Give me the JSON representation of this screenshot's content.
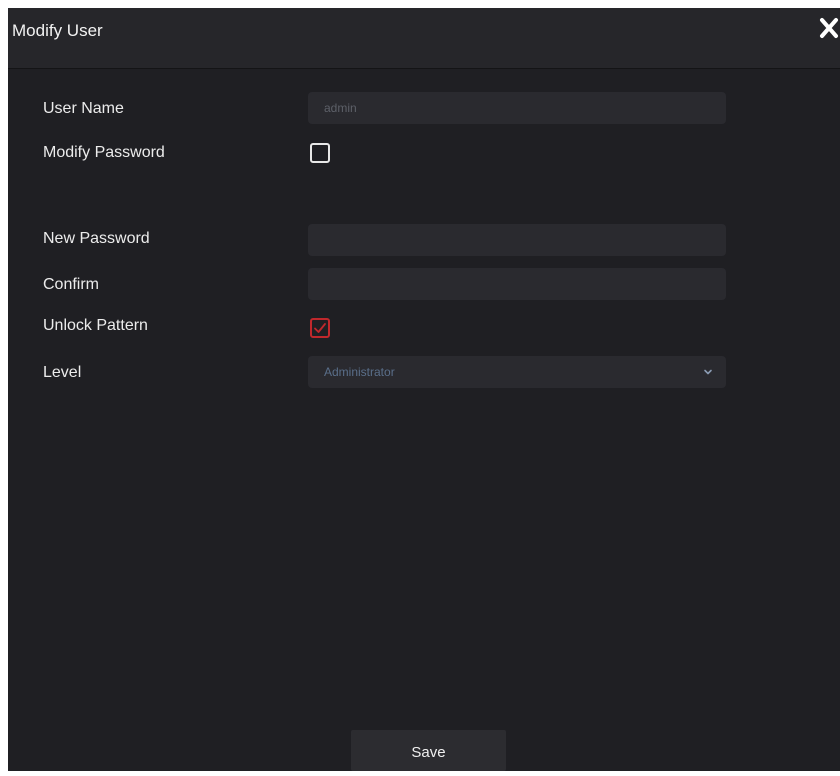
{
  "dialog": {
    "title": "Modify User",
    "close_icon": "close-icon"
  },
  "form": {
    "user_name": {
      "label": "User Name",
      "value": "admin"
    },
    "modify_password": {
      "label": "Modify Password",
      "checked": false
    },
    "new_password": {
      "label": "New Password",
      "value": ""
    },
    "confirm": {
      "label": "Confirm",
      "value": ""
    },
    "unlock_pattern": {
      "label": "Unlock Pattern",
      "checked": true
    },
    "level": {
      "label": "Level",
      "selected": "Administrator"
    }
  },
  "footer": {
    "save_label": "Save"
  },
  "colors": {
    "background": "#1f1f23",
    "title_bar": "#26262a",
    "input": "#2a2a2f",
    "checked_accent": "#c0282c",
    "select_text": "#5a6f8a"
  }
}
